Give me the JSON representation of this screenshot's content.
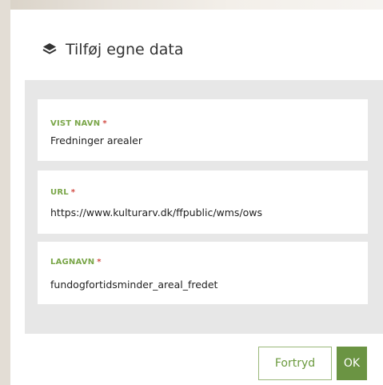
{
  "dialog": {
    "title": "Tilføj egne data",
    "title_icon": "layers-icon"
  },
  "fields": [
    {
      "label": "VIST NAVN",
      "required_mark": "*",
      "value": "Fredninger arealer"
    },
    {
      "label": "URL",
      "required_mark": "*",
      "value": "https://www.kulturarv.dk/ffpublic/wms/ows"
    },
    {
      "label": "LAGNAVN",
      "required_mark": "*",
      "value": "fundogfortidsminder_areal_fredet"
    }
  ],
  "buttons": {
    "cancel_label": "Fortryd",
    "ok_label": "OK"
  },
  "colors": {
    "accent_green": "#6b9443",
    "label_green": "#7aa649",
    "required_red": "#d24b43",
    "panel_gray": "#e7e7e7"
  }
}
